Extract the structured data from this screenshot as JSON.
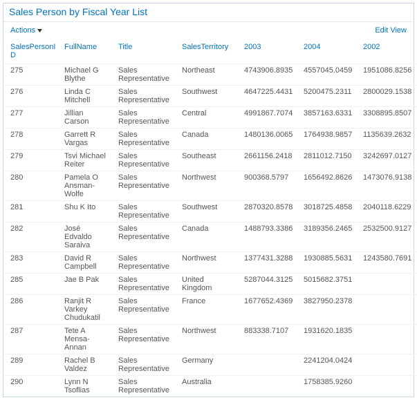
{
  "title": "Sales Person by Fiscal Year List",
  "toolbar": {
    "actions_label": "Actions",
    "edit_view_label": "Edit View"
  },
  "columns": [
    {
      "key": "SalesPersonID",
      "label": "SalesPersonID"
    },
    {
      "key": "FullName",
      "label": "FullName"
    },
    {
      "key": "Title",
      "label": "Title"
    },
    {
      "key": "SalesTerritory",
      "label": "SalesTerritory"
    },
    {
      "key": "y2003",
      "label": "2003"
    },
    {
      "key": "y2004",
      "label": "2004"
    },
    {
      "key": "y2002",
      "label": "2002"
    }
  ],
  "rows": [
    {
      "SalesPersonID": "275",
      "FullName": "Michael G Blythe",
      "Title": "Sales Representative",
      "SalesTerritory": "Northeast",
      "y2003": "4743906.8935",
      "y2004": "4557045.0459",
      "y2002": "1951086.8256"
    },
    {
      "SalesPersonID": "276",
      "FullName": "Linda C Mitchell",
      "Title": "Sales Representative",
      "SalesTerritory": "Southwest",
      "y2003": "4647225.4431",
      "y2004": "5200475.2311",
      "y2002": "2800029.1538"
    },
    {
      "SalesPersonID": "277",
      "FullName": "Jillian Carson",
      "Title": "Sales Representative",
      "SalesTerritory": "Central",
      "y2003": "4991867.7074",
      "y2004": "3857163.6331",
      "y2002": "3308895.8507"
    },
    {
      "SalesPersonID": "278",
      "FullName": "Garrett R Vargas",
      "Title": "Sales Representative",
      "SalesTerritory": "Canada",
      "y2003": "1480136.0065",
      "y2004": "1764938.9857",
      "y2002": "1135639.2632"
    },
    {
      "SalesPersonID": "279",
      "FullName": "Tsvi Michael Reiter",
      "Title": "Sales Representative",
      "SalesTerritory": "Southeast",
      "y2003": "2661156.2418",
      "y2004": "2811012.7150",
      "y2002": "3242697.0127"
    },
    {
      "SalesPersonID": "280",
      "FullName": "Pamela O Ansman-Wolfe",
      "Title": "Sales Representative",
      "SalesTerritory": "Northwest",
      "y2003": "900368.5797",
      "y2004": "1656492.8626",
      "y2002": "1473076.9138"
    },
    {
      "SalesPersonID": "281",
      "FullName": "Shu K Ito",
      "Title": "Sales Representative",
      "SalesTerritory": "Southwest",
      "y2003": "2870320.8578",
      "y2004": "3018725.4858",
      "y2002": "2040118.6229"
    },
    {
      "SalesPersonID": "282",
      "FullName": "José Edvaldo Saraiva",
      "Title": "Sales Representative",
      "SalesTerritory": "Canada",
      "y2003": "1488793.3386",
      "y2004": "3189356.2465",
      "y2002": "2532500.9127"
    },
    {
      "SalesPersonID": "283",
      "FullName": "David R Campbell",
      "Title": "Sales Representative",
      "SalesTerritory": "Northwest",
      "y2003": "1377431.3288",
      "y2004": "1930885.5631",
      "y2002": "1243580.7691"
    },
    {
      "SalesPersonID": "285",
      "FullName": "Jae B Pak",
      "Title": "Sales Representative",
      "SalesTerritory": "United Kingdom",
      "y2003": "5287044.3125",
      "y2004": "5015682.3751",
      "y2002": ""
    },
    {
      "SalesPersonID": "286",
      "FullName": "Ranjit R Varkey Chudukatil",
      "Title": "Sales Representative",
      "SalesTerritory": "France",
      "y2003": "1677652.4369",
      "y2004": "3827950.2378",
      "y2002": ""
    },
    {
      "SalesPersonID": "287",
      "FullName": "Tete A Mensa-Annan",
      "Title": "Sales Representative",
      "SalesTerritory": "Northwest",
      "y2003": "883338.7107",
      "y2004": "1931620.1835",
      "y2002": ""
    },
    {
      "SalesPersonID": "289",
      "FullName": "Rachel B Valdez",
      "Title": "Sales Representative",
      "SalesTerritory": "Germany",
      "y2003": "",
      "y2004": "2241204.0424",
      "y2002": ""
    },
    {
      "SalesPersonID": "290",
      "FullName": "Lynn N Tsoflias",
      "Title": "Sales Representative",
      "SalesTerritory": "Australia",
      "y2003": "",
      "y2004": "1758385.9260",
      "y2002": ""
    }
  ]
}
